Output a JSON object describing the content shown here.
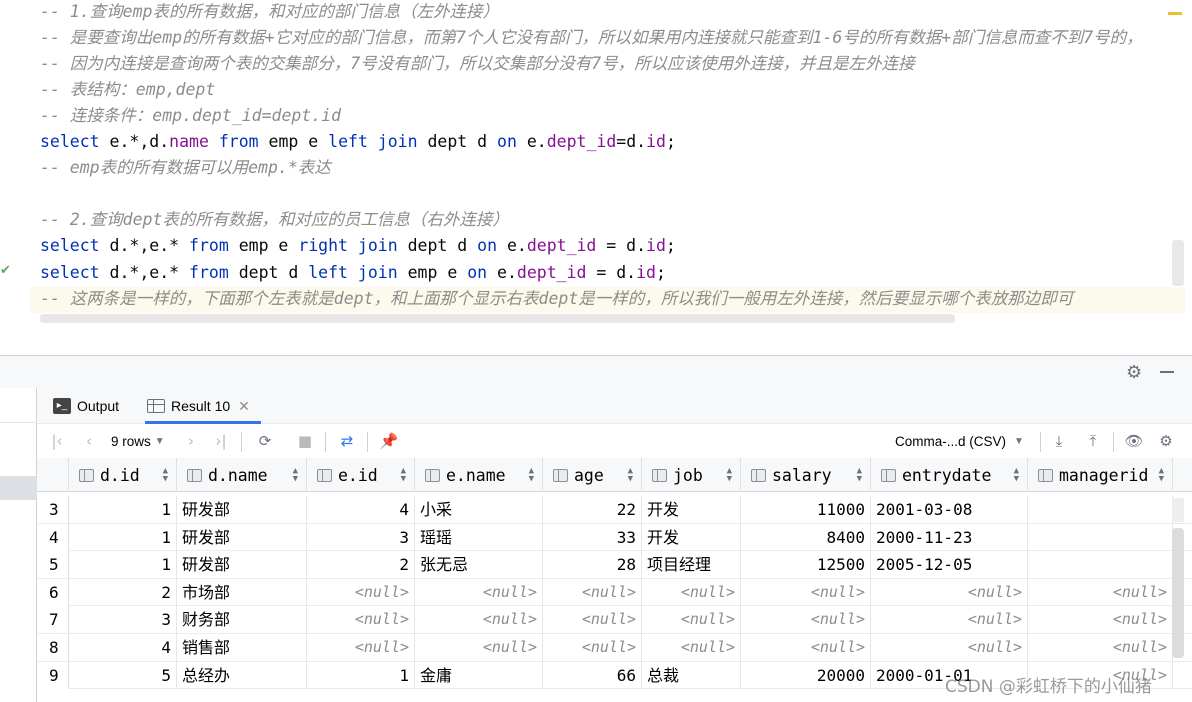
{
  "editor": {
    "lines": [
      {
        "type": "comment",
        "text": "-- 1.查询emp表的所有数据，和对应的部门信息（左外连接）"
      },
      {
        "type": "comment",
        "text": "-- 是要查询出emp的所有数据+它对应的部门信息，而第7个人它没有部门，所以如果用内连接就只能查到1-6号的所有数据+部门信息而查不到7号的，"
      },
      {
        "type": "comment",
        "text": "-- 因为内连接是查询两个表的交集部分，7号没有部门，所以交集部分没有7号，所以应该使用外连接，并且是左外连接"
      },
      {
        "type": "comment",
        "text": "-- 表结构：emp,dept"
      },
      {
        "type": "comment",
        "text": "-- 连接条件：emp.dept_id=dept.id"
      },
      {
        "type": "code",
        "tokens": [
          {
            "k": "kw",
            "t": "select"
          },
          {
            "k": "plain",
            "t": " e.*,d."
          },
          {
            "k": "field",
            "t": "name"
          },
          {
            "k": "plain",
            "t": " "
          },
          {
            "k": "kw",
            "t": "from"
          },
          {
            "k": "plain",
            "t": " emp e "
          },
          {
            "k": "kw",
            "t": "left join"
          },
          {
            "k": "plain",
            "t": " dept d "
          },
          {
            "k": "kw",
            "t": "on"
          },
          {
            "k": "plain",
            "t": " e."
          },
          {
            "k": "field",
            "t": "dept_id"
          },
          {
            "k": "plain",
            "t": "=d."
          },
          {
            "k": "field",
            "t": "id"
          },
          {
            "k": "plain",
            "t": ";"
          }
        ]
      },
      {
        "type": "comment",
        "text": "-- emp表的所有数据可以用emp.*表达"
      },
      {
        "type": "blank",
        "text": ""
      },
      {
        "type": "comment",
        "text": "-- 2.查询dept表的所有数据，和对应的员工信息（右外连接）"
      },
      {
        "type": "code",
        "tokens": [
          {
            "k": "kw",
            "t": "select"
          },
          {
            "k": "plain",
            "t": " d.*,e.* "
          },
          {
            "k": "kw",
            "t": "from"
          },
          {
            "k": "plain",
            "t": " emp e "
          },
          {
            "k": "kw",
            "t": "right join"
          },
          {
            "k": "plain",
            "t": " dept d "
          },
          {
            "k": "kw",
            "t": "on"
          },
          {
            "k": "plain",
            "t": " e."
          },
          {
            "k": "field",
            "t": "dept_id"
          },
          {
            "k": "plain",
            "t": " = d."
          },
          {
            "k": "field",
            "t": "id"
          },
          {
            "k": "plain",
            "t": ";"
          }
        ]
      },
      {
        "type": "code",
        "tokens": [
          {
            "k": "kw",
            "t": "select"
          },
          {
            "k": "plain",
            "t": " d.*,e.* "
          },
          {
            "k": "kw",
            "t": "from"
          },
          {
            "k": "plain",
            "t": " dept d "
          },
          {
            "k": "kw",
            "t": "left join"
          },
          {
            "k": "plain",
            "t": " emp e "
          },
          {
            "k": "kw",
            "t": "on"
          },
          {
            "k": "plain",
            "t": " e."
          },
          {
            "k": "field",
            "t": "dept_id"
          },
          {
            "k": "plain",
            "t": " = d."
          },
          {
            "k": "field",
            "t": "id"
          },
          {
            "k": "plain",
            "t": ";"
          }
        ]
      },
      {
        "type": "comment",
        "text": "-- 这两条是一样的，下面那个左表就是dept，和上面那个显示右表dept是一样的，所以我们一般用左外连接，然后要显示哪个表放那边即可"
      }
    ]
  },
  "tabs": {
    "output": "Output",
    "result": "Result 10"
  },
  "toolbar": {
    "rows_label": "9 rows",
    "format_label": "Comma-...d (CSV)"
  },
  "table": {
    "columns": [
      "d.id",
      "d.name",
      "e.id",
      "e.name",
      "age",
      "job",
      "salary",
      "entrydate",
      "managerid"
    ],
    "rows": [
      {
        "n": "3",
        "cells": [
          "1",
          "研发部",
          "4",
          "小采",
          "22",
          "开发",
          "11000",
          "2001-03-08",
          ""
        ]
      },
      {
        "n": "4",
        "cells": [
          "1",
          "研发部",
          "3",
          "瑶瑶",
          "33",
          "开发",
          "8400",
          "2000-11-23",
          ""
        ]
      },
      {
        "n": "5",
        "cells": [
          "1",
          "研发部",
          "2",
          "张无忌",
          "28",
          "项目经理",
          "12500",
          "2005-12-05",
          ""
        ]
      },
      {
        "n": "6",
        "cells": [
          "2",
          "市场部",
          "<null>",
          "<null>",
          "<null>",
          "<null>",
          "<null>",
          "<null>",
          "<null>"
        ]
      },
      {
        "n": "7",
        "cells": [
          "3",
          "财务部",
          "<null>",
          "<null>",
          "<null>",
          "<null>",
          "<null>",
          "<null>",
          "<null>"
        ]
      },
      {
        "n": "8",
        "cells": [
          "4",
          "销售部",
          "<null>",
          "<null>",
          "<null>",
          "<null>",
          "<null>",
          "<null>",
          "<null>"
        ]
      },
      {
        "n": "9",
        "cells": [
          "5",
          "总经办",
          "1",
          "金庸",
          "66",
          "总裁",
          "20000",
          "2000-01-01",
          "<null>"
        ]
      }
    ]
  },
  "watermark": "CSDN @彩虹桥下的小仙猪"
}
